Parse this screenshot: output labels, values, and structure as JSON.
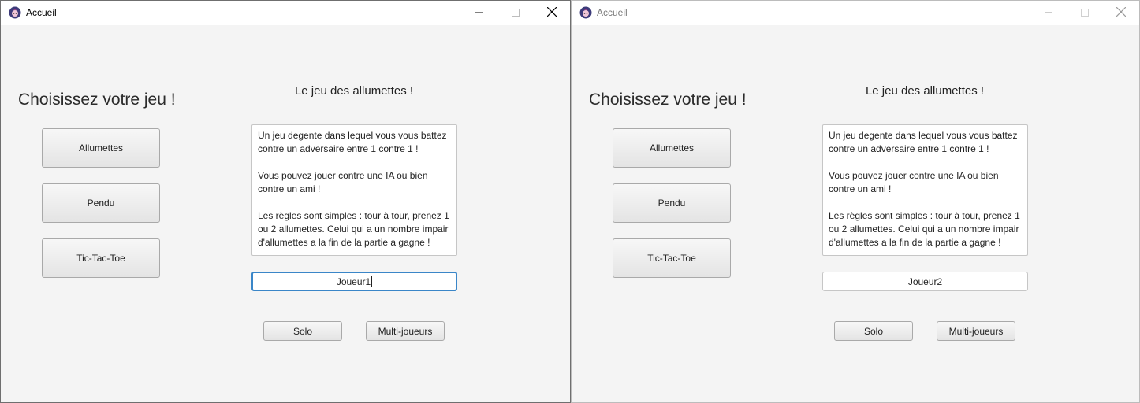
{
  "windows": [
    {
      "title": "Accueil",
      "heading": "Choisissez votre jeu !",
      "menu": [
        "Allumettes",
        "Pendu",
        "Tic-Tac-Toe"
      ],
      "game_title": "Le jeu des allumettes !",
      "description": "Un jeu degente dans lequel vous vous battez contre un adversaire entre 1 contre 1 !\n\nVous pouvez jouer contre une IA ou bien contre un ami !\n\nLes règles sont simples : tour à tour, prenez 1 ou 2 allumettes. Celui qui a un nombre impair d'allumettes a la fin de la partie a gagne !",
      "player_name": "Joueur1",
      "solo_label": "Solo",
      "multi_label": "Multi-joueurs",
      "focused": true
    },
    {
      "title": "Accueil",
      "heading": "Choisissez votre jeu !",
      "menu": [
        "Allumettes",
        "Pendu",
        "Tic-Tac-Toe"
      ],
      "game_title": "Le jeu des allumettes !",
      "description": "Un jeu degente dans lequel vous vous battez contre un adversaire entre 1 contre 1 !\n\nVous pouvez jouer contre une IA ou bien contre un ami !\n\nLes règles sont simples : tour à tour, prenez 1 ou 2 allumettes. Celui qui a un nombre impair d'allumettes a la fin de la partie a gagne !",
      "player_name": "Joueur2",
      "solo_label": "Solo",
      "multi_label": "Multi-joueurs",
      "focused": false
    }
  ],
  "icons": {
    "app": "app-logo-icon",
    "minimize": "minimize-icon",
    "maximize": "maximize-icon",
    "close": "close-icon"
  },
  "colors": {
    "focus_border": "#3a86c8",
    "window_bg": "#f4f4f4"
  }
}
